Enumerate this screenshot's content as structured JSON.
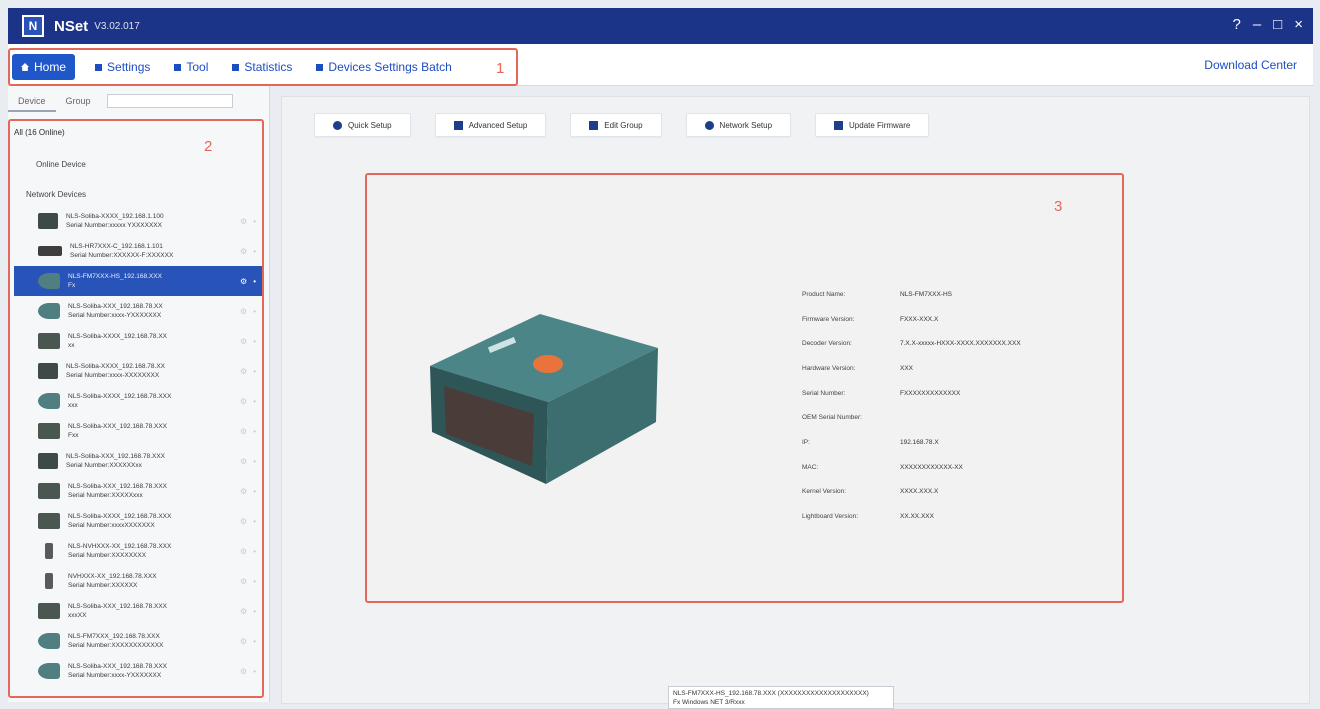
{
  "titlebar": {
    "app_name": "NSet",
    "version": "V3.02.017",
    "logo_glyph": "N",
    "help_glyph": "?",
    "minimize_glyph": "–",
    "restore_glyph": "□",
    "close_glyph": "×",
    "color": "#1c3488"
  },
  "menu": {
    "items": [
      {
        "label": "Home",
        "icon": "home-icon"
      },
      {
        "label": "Settings",
        "icon": "settings-icon"
      },
      {
        "label": "Tool",
        "icon": "tool-icon"
      },
      {
        "label": "Statistics",
        "icon": "statistics-icon"
      },
      {
        "label": "Devices Settings Batch",
        "icon": "batch-icon"
      }
    ],
    "download_center": "Download Center",
    "accent": "#1f56c8"
  },
  "annotations": {
    "n1": "1",
    "n2": "2",
    "n3": "3",
    "color": "#e2685a"
  },
  "left": {
    "tabs": [
      "Device",
      "Group"
    ],
    "search_placeholder": "",
    "root_label": "All (16 Online)",
    "online_label": "Online Device",
    "network_label": "Network Devices",
    "devices": [
      {
        "line1": "NLS-Soliba-XXXX_192.168.1.100",
        "line2": "Serial Number:xxxxx YXXXXXXX",
        "thumb": "mini"
      },
      {
        "line1": "NLS-HR7XXX-C_192.168.1.101",
        "line2": "Serial Number:XXXXXX-F:XXXXXX",
        "thumb": "flat"
      },
      {
        "line1": "NLS-FM7XXX-HS_192.168.XXX",
        "line2": "Fx",
        "thumb": "teal"
      },
      {
        "line1": "NLS-Soliba-XXX_192.168.78.XX",
        "line2": "Serial Number:xxxx-YXXXXXXX",
        "thumb": "teal"
      },
      {
        "line1": "NLS-Soliba-XXXX_192.168.78.XX",
        "line2": "xx",
        "thumb": "box"
      },
      {
        "line1": "NLS-Soliba-XXXX_192.168.78.XX",
        "line2": "Serial Number:xxxx-XXXXXXXX",
        "thumb": "mini"
      },
      {
        "line1": "NLS-Soliba-XXXX_192.168.78.XXX",
        "line2": "xxx",
        "thumb": "teal"
      },
      {
        "line1": "NLS-Soliba-XXX_192.168.78.XXX",
        "line2": "Fxx",
        "thumb": "box"
      },
      {
        "line1": "NLS-Soliba-XXX_192.168.78.XXX",
        "line2": "Serial Number:XXXXXXxx",
        "thumb": "mini"
      },
      {
        "line1": "NLS-Soliba-XXX_192.168.78.XXX",
        "line2": "Serial Number:XXXXXxxx",
        "thumb": "box"
      },
      {
        "line1": "NLS-Soliba-XXXX_192.168.78.XXX",
        "line2": "Serial Number:xxxxXXXXXXX",
        "thumb": "box"
      },
      {
        "line1": "NLS-NVHXXX-XX_192.168.78.XXX",
        "line2": "Serial Number:XXXXXXXX",
        "thumb": "hand"
      },
      {
        "line1": "NVHXXX-XX_192.168.78.XXX",
        "line2": "Serial Number:XXXXXX",
        "thumb": "hand"
      },
      {
        "line1": "NLS-Soliba-XXX_192.168.78.XXX",
        "line2": "xxxXX",
        "thumb": "box"
      },
      {
        "line1": "NLS-FM7XXX_192.168.78.XXX",
        "line2": "Serial Number:XXXXXXXXXXXX",
        "thumb": "teal"
      },
      {
        "line1": "NLS-Soliba-XXX_192.168.78.XXX",
        "line2": "Serial Number:xxxx-YXXXXXXX",
        "thumb": "teal"
      }
    ],
    "selected_index": 2
  },
  "toolbar": {
    "buttons": [
      {
        "label": "Quick Setup",
        "icon": "gear-icon"
      },
      {
        "label": "Advanced Setup",
        "icon": "wrench-icon"
      },
      {
        "label": "Edit Group",
        "icon": "users-icon"
      },
      {
        "label": "Network Setup",
        "icon": "network-icon"
      },
      {
        "label": "Update Firmware",
        "icon": "upload-icon"
      }
    ]
  },
  "device_info": {
    "rows": [
      {
        "key": "Product Name:",
        "value": "NLS-FM7XXX-HS"
      },
      {
        "key": "Firmware Version:",
        "value": "FXXX-XXX.X"
      },
      {
        "key": "Decoder Version:",
        "value": "7.X.X-xxxxx-HXXX-XXXX.XXXXXXX.XXX"
      },
      {
        "key": "Hardware Version:",
        "value": "XXX"
      },
      {
        "key": "Serial Number:",
        "value": "FXXXXXXXXXXXXX"
      },
      {
        "key": "OEM Serial Number:",
        "value": ""
      },
      {
        "key": "IP:",
        "value": "192.168.78.X"
      },
      {
        "key": "MAC:",
        "value": "XXXXXXXXXXXX-XX"
      },
      {
        "key": "Kernel Version:",
        "value": "XXXX.XXX.X"
      },
      {
        "key": "Lightboard Version:",
        "value": "XX.XX.XXX"
      }
    ]
  },
  "status_tip": {
    "line1": "NLS-FM7XXX-HS_192.168.78.XXX (XXXXXXXXXXXXXXXXXXXX)",
    "line2": "Fx Windows  NET 3/Rxxx"
  }
}
